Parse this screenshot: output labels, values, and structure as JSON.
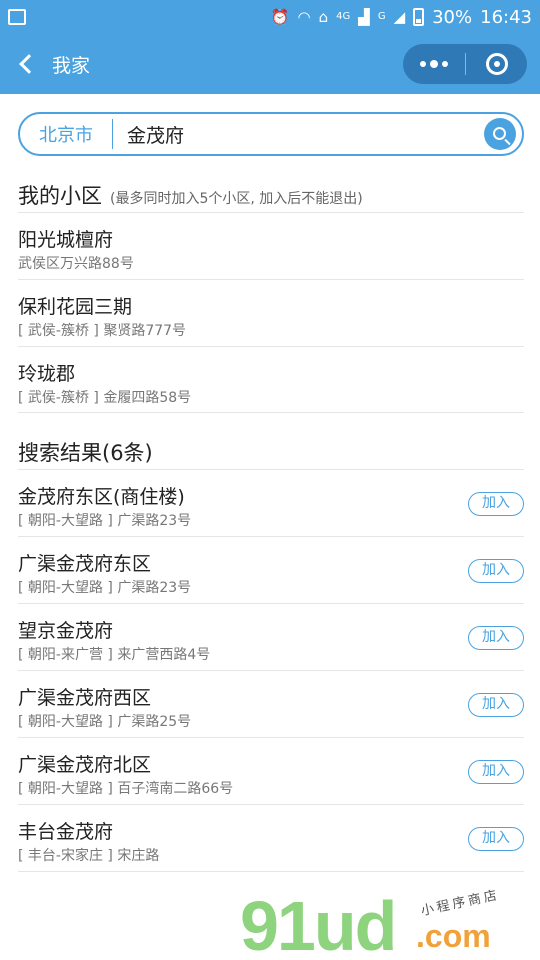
{
  "status_bar": {
    "network_4g": "4G",
    "network_g": "G",
    "battery": "30%",
    "time": "16:43"
  },
  "nav": {
    "title": "我家"
  },
  "search": {
    "city": "北京市",
    "query": "金茂府"
  },
  "my_communities": {
    "title": "我的小区",
    "hint": "(最多同时加入5个小区, 加入后不能退出)",
    "items": [
      {
        "name": "阳光城檀府",
        "address": "武侯区万兴路88号"
      },
      {
        "name": "保利花园三期",
        "address": "[ 武侯-簇桥 ] 聚贤路777号"
      },
      {
        "name": "玲珑郡",
        "address": "[ 武侯-簇桥 ] 金履四路58号"
      }
    ]
  },
  "results": {
    "title": "搜索结果(6条)",
    "add_label": "加入",
    "items": [
      {
        "name": "金茂府东区(商住楼)",
        "address": "[ 朝阳-大望路 ] 广渠路23号"
      },
      {
        "name": "广渠金茂府东区",
        "address": "[ 朝阳-大望路 ] 广渠路23号"
      },
      {
        "name": "望京金茂府",
        "address": "[ 朝阳-来广营 ] 来广营西路4号"
      },
      {
        "name": "广渠金茂府西区",
        "address": "[ 朝阳-大望路 ] 广渠路25号"
      },
      {
        "name": "广渠金茂府北区",
        "address": "[ 朝阳-大望路 ] 百子湾南二路66号"
      },
      {
        "name": "丰台金茂府",
        "address": "[ 丰台-宋家庄 ] 宋庄路"
      }
    ]
  },
  "watermark": {
    "brand": "91ud",
    "suffix": ".com",
    "tagline": "小程序商店"
  },
  "colors": {
    "accent": "#4aa3e0",
    "capsule": "#2f79b6"
  },
  "icons": [
    "back-chevron-icon",
    "more-dots-icon",
    "close-target-icon",
    "search-icon",
    "alarm-icon",
    "wifi-icon",
    "home-icon",
    "signal-icon",
    "battery-icon"
  ]
}
